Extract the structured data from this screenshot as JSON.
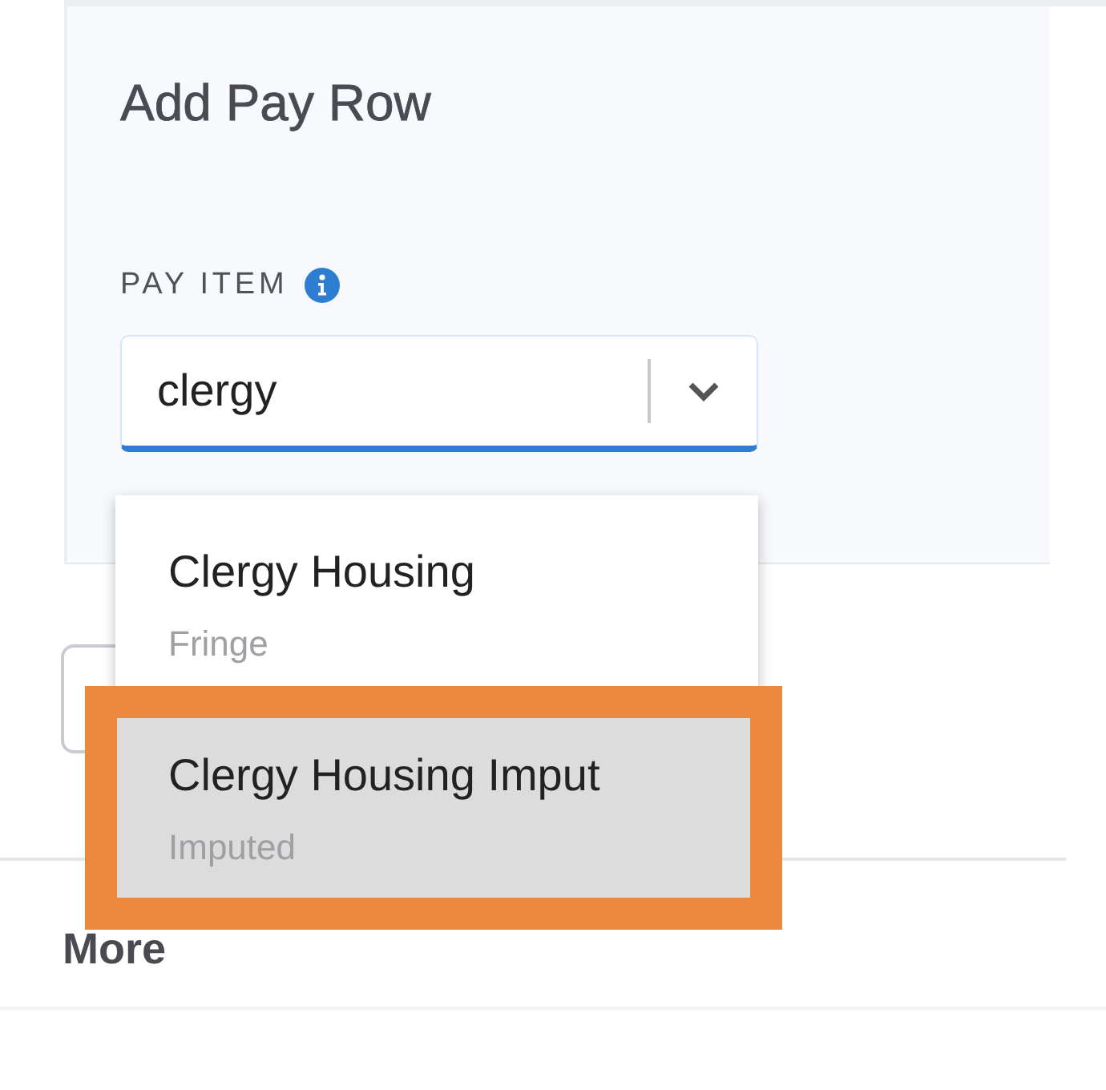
{
  "panel": {
    "title": "Add Pay Row",
    "field": {
      "label": "PAY ITEM",
      "value": "clergy"
    }
  },
  "dropdown": {
    "options": [
      {
        "name": "Clergy Housing",
        "type": "Fringe",
        "selected": false
      },
      {
        "name": "Clergy Housing Imput",
        "type": "Imputed",
        "selected": true
      }
    ]
  },
  "section": {
    "title": "More"
  }
}
